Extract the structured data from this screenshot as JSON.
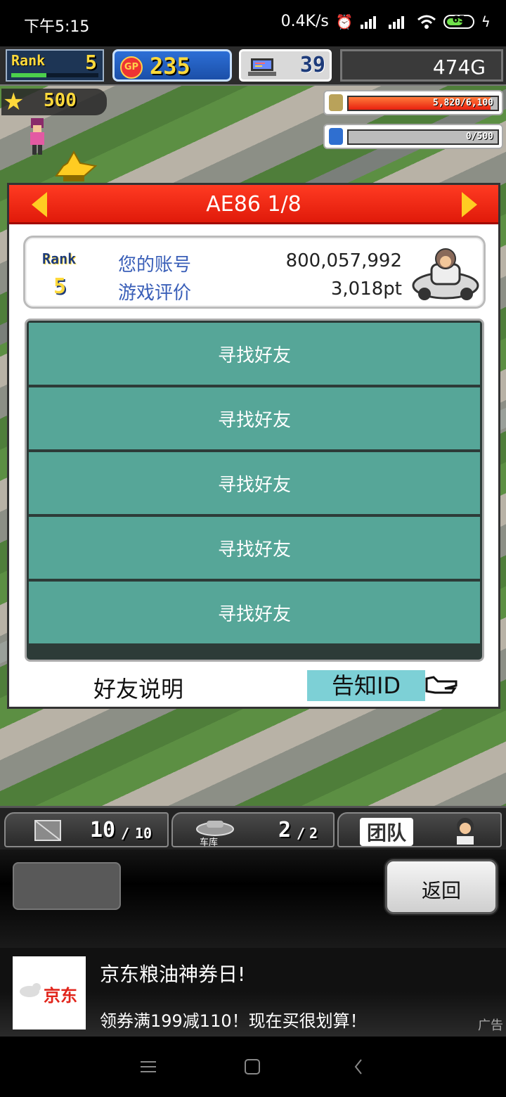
{
  "status_bar": {
    "time": "下午5:15",
    "net_speed": "0.4K/s",
    "battery": "65",
    "battery_level": 0.65
  },
  "hud": {
    "rank_label": "Rank",
    "rank_value": "5",
    "gp_label": "GP",
    "gp_value": "235",
    "research_value": "39",
    "money": "474G",
    "star_value": "500",
    "fuel_text": "5,820/6,100",
    "fuel_level": 0.954,
    "water_text": "0/500",
    "water_level": 0
  },
  "panel": {
    "title": "AE86 1/8",
    "rank_label": "Rank",
    "rank_value": "5",
    "account_label": "您的账号",
    "account_value": "800,057,992",
    "rating_label": "游戏评价",
    "rating_value": "3,018pt",
    "friend_slots": [
      {
        "label": "寻找好友"
      },
      {
        "label": "寻找好友"
      },
      {
        "label": "寻找好友"
      },
      {
        "label": "寻找好友"
      },
      {
        "label": "寻找好友"
      }
    ],
    "explain_label": "好友说明",
    "notify_label": "告知ID"
  },
  "bottom_bar": {
    "parts_count": "10",
    "parts_max": "10",
    "garage_label": "车库",
    "garage_count": "2",
    "garage_max": "2",
    "team_label": "团队"
  },
  "back_label": "返回",
  "ad": {
    "brand": "京东",
    "title": "京东粮油神券日!",
    "subtitle": "领券满199减110！现在买很划算！",
    "tag": "广告"
  },
  "colors": {
    "header_red": "#e01a0a",
    "slot_teal": "#56a698",
    "notify_cyan": "#7dd0d6",
    "label_blue": "#3a5fb8"
  }
}
